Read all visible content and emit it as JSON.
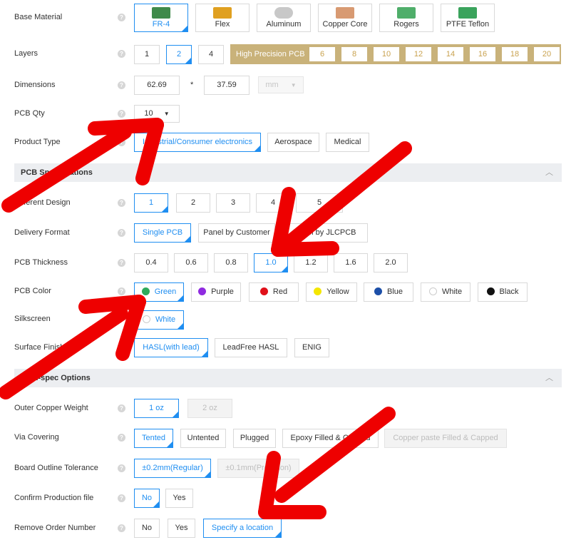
{
  "base_material": {
    "label": "Base Material",
    "options": [
      {
        "label": "FR-4",
        "icon": "fr4-board-icon",
        "color": "#3f8a4a"
      },
      {
        "label": "Flex",
        "icon": "flex-pcb-icon",
        "color": "#e0a020"
      },
      {
        "label": "Aluminum",
        "icon": "aluminum-pcb-icon",
        "color": "#c8c8c8"
      },
      {
        "label": "Copper Core",
        "icon": "copper-core-icon",
        "color": "#d89a72"
      },
      {
        "label": "Rogers",
        "icon": "rogers-board-icon",
        "color": "#4fae6a"
      },
      {
        "label": "PTFE Teflon",
        "icon": "ptfe-board-icon",
        "color": "#3aa35c"
      }
    ]
  },
  "layers": {
    "label": "Layers",
    "options": [
      "1",
      "2",
      "4"
    ],
    "high_precision_title": "High Precision PCB",
    "high_precision_options": [
      "6",
      "8",
      "10",
      "12",
      "14",
      "16",
      "18",
      "20"
    ]
  },
  "dimensions": {
    "label": "Dimensions",
    "width": "62.69",
    "separator": "*",
    "height": "37.59",
    "unit": "mm"
  },
  "pcb_qty": {
    "label": "PCB Qty",
    "value": "10"
  },
  "product_type": {
    "label": "Product Type",
    "options": [
      "Industrial/Consumer electronics",
      "Aerospace",
      "Medical"
    ]
  },
  "pcb_spec_section": {
    "title": "PCB Specifications"
  },
  "different_design": {
    "label": "Different Design",
    "options": [
      "1",
      "2",
      "3",
      "4",
      "5"
    ]
  },
  "delivery_format": {
    "label": "Delivery Format",
    "options": [
      "Single PCB",
      "Panel by Customer",
      "Panel by JLCPCB"
    ]
  },
  "pcb_thickness": {
    "label": "PCB Thickness",
    "options": [
      "0.4",
      "0.6",
      "0.8",
      "1.0",
      "1.2",
      "1.6",
      "2.0"
    ]
  },
  "pcb_color": {
    "label": "PCB Color",
    "options": [
      {
        "label": "Green",
        "color": "#2eaa5c"
      },
      {
        "label": "Purple",
        "color": "#8f2be0"
      },
      {
        "label": "Red",
        "color": "#e0101a"
      },
      {
        "label": "Yellow",
        "color": "#f4e600"
      },
      {
        "label": "Blue",
        "color": "#1c4fa8"
      },
      {
        "label": "White",
        "color": "#ffffff"
      },
      {
        "label": "Black",
        "color": "#111111"
      }
    ]
  },
  "silkscreen": {
    "label": "Silkscreen",
    "value": "White"
  },
  "surface_finish": {
    "label": "Surface Finish",
    "options": [
      "HASL(with lead)",
      "LeadFree HASL",
      "ENIG"
    ]
  },
  "high_spec_section": {
    "title": "High-spec Options"
  },
  "outer_copper": {
    "label": "Outer Copper Weight",
    "options": [
      "1 oz",
      "2 oz"
    ]
  },
  "via_covering": {
    "label": "Via Covering",
    "options": [
      "Tented",
      "Untented",
      "Plugged",
      "Epoxy Filled & Capped",
      "Copper paste Filled & Capped"
    ]
  },
  "outline_tolerance": {
    "label": "Board Outline Tolerance",
    "options": [
      "±0.2mm(Regular)",
      "±0.1mm(Precision)"
    ]
  },
  "confirm_file": {
    "label": "Confirm Production file",
    "options": [
      "No",
      "Yes"
    ]
  },
  "remove_order": {
    "label": "Remove Order Number",
    "options": [
      "No",
      "Yes",
      "Specify a location"
    ]
  },
  "help_glyph": "?",
  "annotation_color": "#ee0000"
}
